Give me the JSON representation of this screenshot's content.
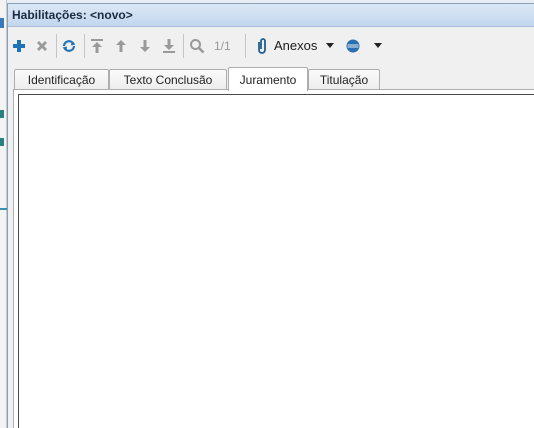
{
  "window": {
    "title": "Habilitações: <novo>"
  },
  "toolbar": {
    "buttons": [
      {
        "name": "add",
        "icon": "plus-icon",
        "color": "#1f73b7",
        "enabled": true
      },
      {
        "name": "delete",
        "icon": "x-icon",
        "color": "#9a9a9a",
        "enabled": false
      },
      {
        "name": "refresh",
        "icon": "refresh-icon",
        "color": "#1f73b7",
        "enabled": true
      },
      {
        "name": "first",
        "icon": "arrow-first-icon",
        "color": "#9a9a9a",
        "enabled": false
      },
      {
        "name": "previous",
        "icon": "arrow-up-icon",
        "color": "#9a9a9a",
        "enabled": false
      },
      {
        "name": "next",
        "icon": "arrow-down-icon",
        "color": "#9a9a9a",
        "enabled": false
      },
      {
        "name": "last",
        "icon": "arrow-last-icon",
        "color": "#9a9a9a",
        "enabled": false
      },
      {
        "name": "search",
        "icon": "magnifier-icon",
        "color": "#9a9a9a",
        "enabled": false
      }
    ],
    "page_count": "1/1",
    "attachments_label": "Anexos"
  },
  "tabs": [
    {
      "label": "Identificação",
      "active": false
    },
    {
      "label": "Texto Conclusão",
      "active": false
    },
    {
      "label": "Juramento",
      "active": true
    },
    {
      "label": "Titulação",
      "active": false
    }
  ],
  "content": {
    "active_tab": "Juramento",
    "editor_text": ""
  }
}
